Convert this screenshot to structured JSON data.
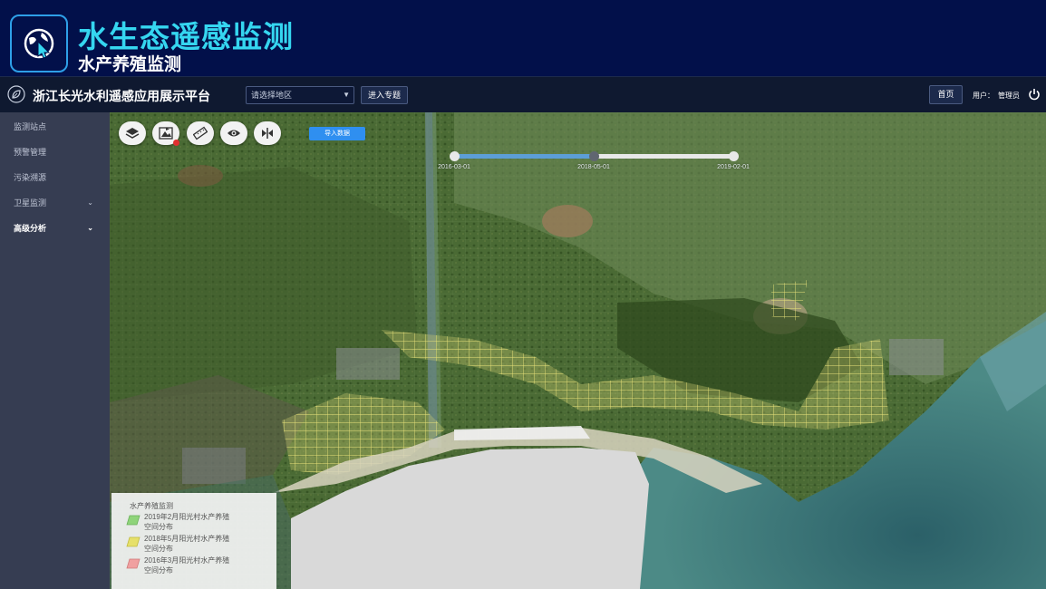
{
  "banner": {
    "title": "水生态遥感监测",
    "subtitle": "水产养殖监测",
    "logo_icon": "globe-cursor-icon"
  },
  "navbar": {
    "platform_title": "浙江长光水利遥感应用展示平台",
    "region_select": {
      "selected": "请选择地区",
      "icon": "chevron-down-icon"
    },
    "enter_label": "进入专题",
    "home_label": "首页",
    "user_label": "用户：",
    "user_name": "管理员",
    "power_icon": "power-icon"
  },
  "sidebar": {
    "items": [
      {
        "label": "监测站点",
        "expandable": false
      },
      {
        "label": "预警管理",
        "expandable": false
      },
      {
        "label": "污染溯源",
        "expandable": false
      },
      {
        "label": "卫星监测",
        "expandable": true
      },
      {
        "label": "高级分析",
        "expandable": true,
        "active": true
      }
    ]
  },
  "map": {
    "toolbar": [
      {
        "icon": "layers-icon"
      },
      {
        "icon": "flag-icon",
        "badge": true
      },
      {
        "icon": "ruler-icon"
      },
      {
        "icon": "eye-icon"
      },
      {
        "icon": "split-compare-icon"
      }
    ],
    "import_label": "导入数据",
    "timeline": {
      "dates": [
        "2016-03-01",
        "2018-05-01",
        "2019-02-01"
      ],
      "selected": "2018-05-01"
    },
    "legend": {
      "title": "水产养殖监测",
      "items": [
        {
          "label": "2019年2月阳光村水产养殖空间分布",
          "color": "#8fd47a"
        },
        {
          "label": "2018年5月阳光村水产养殖空间分布",
          "color": "#e6e06a"
        },
        {
          "label": "2016年3月阳光村水产养殖空间分布",
          "color": "#f0a0a0"
        }
      ]
    }
  }
}
